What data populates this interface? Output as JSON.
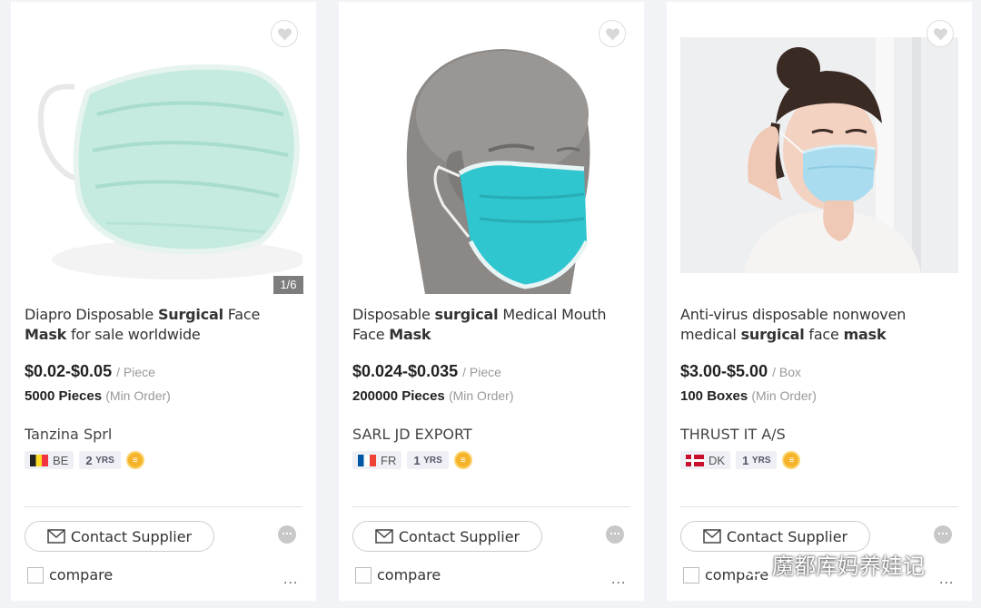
{
  "products": [
    {
      "title_parts": [
        {
          "text": "Diapro Disposable ",
          "bold": false
        },
        {
          "text": "Surgical",
          "bold": true
        },
        {
          "text": " Face ",
          "bold": false
        },
        {
          "text": "Mask",
          "bold": true
        },
        {
          "text": " for sale worldwide",
          "bold": false
        }
      ],
      "price": "$0.02-$0.05",
      "price_unit": "/ Piece",
      "moq": "5000 Pieces",
      "min_order_label": "(Min Order)",
      "supplier": "Tanzina Sprl",
      "country_code": "BE",
      "years": "2",
      "years_suffix": "YRS",
      "image_counter": "1/6",
      "image_icon": "flat-surgical-mask-image"
    },
    {
      "title_parts": [
        {
          "text": "Disposable ",
          "bold": false
        },
        {
          "text": "surgical",
          "bold": true
        },
        {
          "text": " Medical Mouth Face ",
          "bold": false
        },
        {
          "text": "Mask",
          "bold": true
        }
      ],
      "price": "$0.024-$0.035",
      "price_unit": "/ Piece",
      "moq": "200000 Pieces",
      "min_order_label": "(Min Order)",
      "supplier": "SARL JD EXPORT",
      "country_code": "FR",
      "years": "1",
      "years_suffix": "YRS",
      "image_icon": "mannequin-head-mask-image"
    },
    {
      "title_parts": [
        {
          "text": "Anti-virus disposable nonwoven medical ",
          "bold": false
        },
        {
          "text": "surgical",
          "bold": true
        },
        {
          "text": " face ",
          "bold": false
        },
        {
          "text": "mask",
          "bold": true
        }
      ],
      "price": "$3.00-$5.00",
      "price_unit": "/ Box",
      "moq": "100 Boxes",
      "min_order_label": "(Min Order)",
      "supplier": "THRUST IT A/S",
      "country_code": "DK",
      "years": "1",
      "years_suffix": "YRS",
      "image_icon": "woman-wearing-mask-image"
    }
  ],
  "contact_label": "Contact Supplier",
  "compare_label": "compare",
  "more_label": "...",
  "watermark_text": "魔都库妈养娃记",
  "colors": {
    "mask_mint": "#bfe8de",
    "mask_teal": "#2fc6cf",
    "mask_blue": "#a9dcee",
    "medal": "#f5b32a",
    "page_bg": "#f2f3f7"
  }
}
